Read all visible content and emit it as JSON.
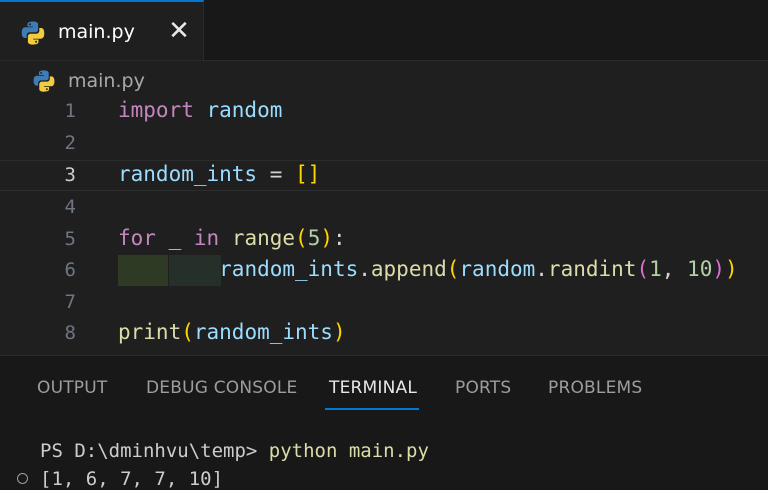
{
  "tab": {
    "filename": "main.py",
    "close_glyph": "✕",
    "icon": "python-file-icon"
  },
  "breadcrumb": {
    "filename": "main.py",
    "icon": "python-file-icon"
  },
  "editor": {
    "current_line": 3,
    "lines": [
      {
        "number": "1",
        "tokens": [
          {
            "t": "import",
            "c": "kw"
          },
          {
            "t": " random",
            "c": "id"
          }
        ]
      },
      {
        "number": "2",
        "tokens": []
      },
      {
        "number": "3",
        "tokens": [
          {
            "t": "random_ints",
            "c": "id"
          },
          {
            "t": " = ",
            "c": "op"
          },
          {
            "t": "[]",
            "c": "b1"
          }
        ]
      },
      {
        "number": "4",
        "tokens": []
      },
      {
        "number": "5",
        "tokens": [
          {
            "t": "for",
            "c": "kw"
          },
          {
            "t": " _ ",
            "c": "id"
          },
          {
            "t": "in",
            "c": "kw"
          },
          {
            "t": " ",
            "c": "op"
          },
          {
            "t": "range",
            "c": "fn"
          },
          {
            "t": "(",
            "c": "b1"
          },
          {
            "t": "5",
            "c": "num"
          },
          {
            "t": ")",
            "c": "b1"
          },
          {
            "t": ":",
            "c": "op"
          }
        ]
      },
      {
        "number": "6",
        "indent": true,
        "tokens": [
          {
            "t": "        ",
            "c": "op"
          },
          {
            "t": "random_ints",
            "c": "id"
          },
          {
            "t": ".",
            "c": "op"
          },
          {
            "t": "append",
            "c": "fn"
          },
          {
            "t": "(",
            "c": "b1"
          },
          {
            "t": "random",
            "c": "id"
          },
          {
            "t": ".",
            "c": "op"
          },
          {
            "t": "randint",
            "c": "fn"
          },
          {
            "t": "(",
            "c": "b2"
          },
          {
            "t": "1",
            "c": "num"
          },
          {
            "t": ", ",
            "c": "op"
          },
          {
            "t": "10",
            "c": "num"
          },
          {
            "t": ")",
            "c": "b2"
          },
          {
            "t": ")",
            "c": "b1"
          }
        ]
      },
      {
        "number": "7",
        "tokens": []
      },
      {
        "number": "8",
        "tokens": [
          {
            "t": "print",
            "c": "fn"
          },
          {
            "t": "(",
            "c": "b1"
          },
          {
            "t": "random_ints",
            "c": "id"
          },
          {
            "t": ")",
            "c": "b1"
          }
        ]
      }
    ]
  },
  "panel": {
    "tabs": [
      {
        "label": "OUTPUT",
        "active": false
      },
      {
        "label": "DEBUG CONSOLE",
        "active": false
      },
      {
        "label": "TERMINAL",
        "active": true
      },
      {
        "label": "PORTS",
        "active": false
      },
      {
        "label": "PROBLEMS",
        "active": false
      }
    ],
    "terminal": {
      "prompt": "PS D:\\dminhvu\\temp> ",
      "command": "python main.py",
      "output": "[1, 6, 7, 7, 10]"
    }
  },
  "colors": {
    "accent": "#0078d4",
    "background": "#1f1f1f",
    "panel_background": "#181818"
  }
}
